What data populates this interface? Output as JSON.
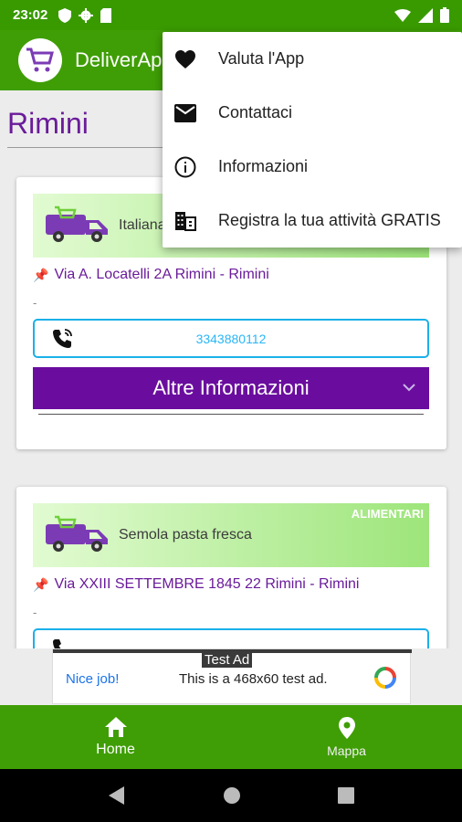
{
  "status_bar": {
    "time": "23:02"
  },
  "app_bar": {
    "title": "DeliverApp"
  },
  "page": {
    "city": "Rimini"
  },
  "cards": [
    {
      "name": "Italiana",
      "category": "",
      "address": "Via A. Locatelli 2A Rimini - Rimini",
      "note": "-",
      "phone": "3343880112",
      "more_label": "Altre Informazioni"
    },
    {
      "name": "Semola pasta fresca",
      "category": "ALIMENTARI",
      "address": "Via XXIII SETTEMBRE 1845 22 Rimini - Rimini",
      "note": "-"
    }
  ],
  "ad": {
    "label": "Test Ad",
    "nice": "Nice job!",
    "text": "This is a 468x60 test ad."
  },
  "bottom_nav": {
    "home_label": "Home",
    "map_label": "Mappa"
  },
  "menu": {
    "items": [
      {
        "label": "Valuta l'App",
        "icon": "heart-icon"
      },
      {
        "label": "Contattaci",
        "icon": "mail-icon"
      },
      {
        "label": "Informazioni",
        "icon": "info-icon"
      },
      {
        "label": "Registra la tua attività GRATIS",
        "icon": "building-icon"
      }
    ]
  },
  "colors": {
    "primary_green": "#3f9e05",
    "accent_purple": "#6a0d9e",
    "phone_blue": "#29b6f6"
  }
}
